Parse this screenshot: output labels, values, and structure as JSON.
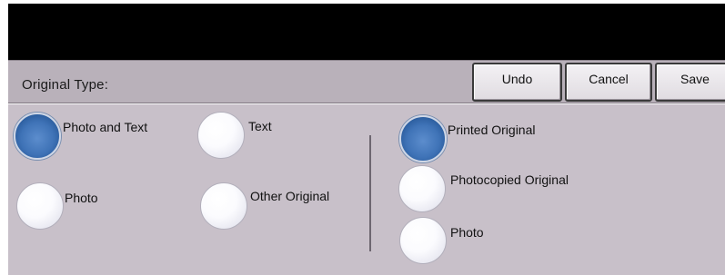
{
  "header": {
    "title": "Original Type:",
    "buttons": {
      "undo": "Undo",
      "cancel": "Cancel",
      "save": "Save"
    }
  },
  "original_type": {
    "selected": "Photo and Text",
    "options": [
      {
        "label": "Photo and Text",
        "selected": true
      },
      {
        "label": "Text",
        "selected": false
      },
      {
        "label": "Photo",
        "selected": false
      },
      {
        "label": "Other Original",
        "selected": false
      }
    ]
  },
  "original_source": {
    "selected": "Printed Original",
    "options": [
      {
        "label": "Printed Original",
        "selected": true
      },
      {
        "label": "Photocopied Original",
        "selected": false
      },
      {
        "label": "Photo",
        "selected": false
      }
    ]
  },
  "colors": {
    "selected_radio": "#3f73b7",
    "panel_background": "#c8c0c9",
    "header_background": "#b9b1ba"
  }
}
